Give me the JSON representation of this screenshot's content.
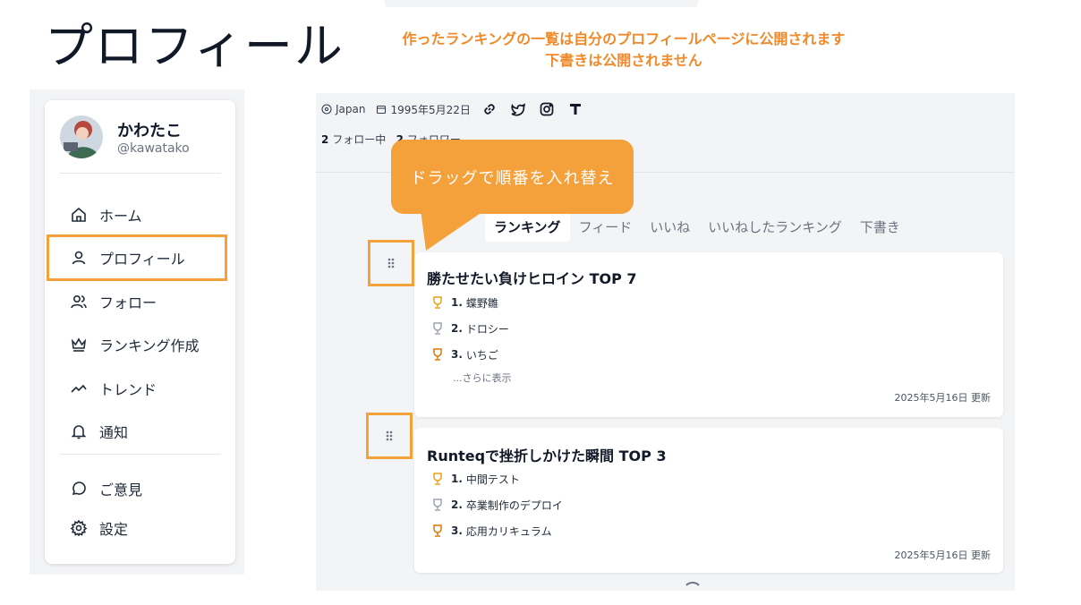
{
  "page_heading": "プロフィール",
  "annotation": {
    "line1": "作ったランキングの一覧は自分のプロフィールページに公開されます",
    "line2": "下書きは公開されません"
  },
  "tooltip": "ドラッグで順番を入れ替え",
  "user": {
    "name": "かわたこ",
    "handle": "@kawatako"
  },
  "nav": {
    "home": "ホーム",
    "profile": "プロフィール",
    "follow": "フォロー",
    "create_ranking": "ランキング作成",
    "trend": "トレンド",
    "notifications": "通知",
    "feedback": "ご意見",
    "settings": "設定"
  },
  "profile_meta": {
    "location": "Japan",
    "birthday": "1995年5月22日",
    "following_count": "2",
    "following_label": "フォロー中",
    "followers_count": "2",
    "followers_label": "フォロワー"
  },
  "tabs": [
    "ランキング",
    "フィード",
    "いいね",
    "いいねしたランキング",
    "下書き"
  ],
  "rankings": [
    {
      "title": "勝たせたい負けヒロイン TOP 7",
      "items": [
        {
          "rank": "1.",
          "name": "蝶野雛"
        },
        {
          "rank": "2.",
          "name": "ドロシー"
        },
        {
          "rank": "3.",
          "name": "いちご"
        }
      ],
      "show_more": "...さらに表示",
      "updated": "2025年5月16日 更新"
    },
    {
      "title": "Runteqで挫折しかけた瞬間 TOP 3",
      "items": [
        {
          "rank": "1.",
          "name": "中間テスト"
        },
        {
          "rank": "2.",
          "name": "卒業制作のデプロイ"
        },
        {
          "rank": "3.",
          "name": "応用カリキュラム"
        }
      ],
      "updated": "2025年5月16日 更新"
    }
  ],
  "colors": {
    "accent": "#f4a03b",
    "annotation_text": "#f0892a",
    "gold": "#e8a317",
    "silver": "#9ca3af",
    "bronze": "#d97706"
  }
}
